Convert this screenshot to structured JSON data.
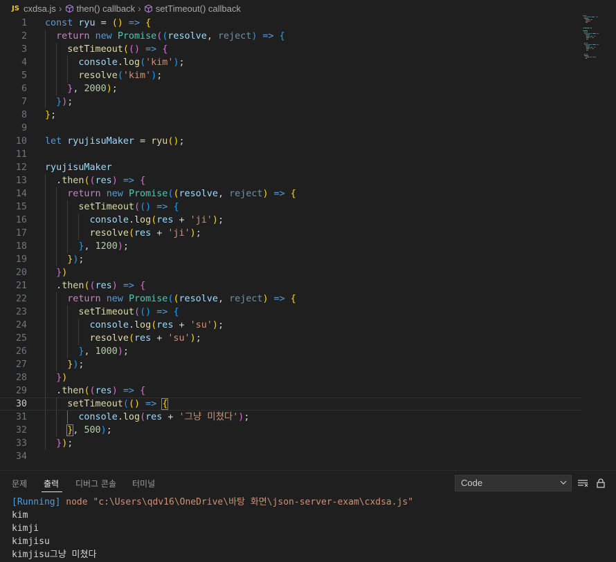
{
  "breadcrumb": {
    "file_badge": "JS",
    "file": "cxdsa.js",
    "items": [
      "then() callback",
      "setTimeout() callback"
    ]
  },
  "editor": {
    "active_line": 30,
    "lines": [
      [
        [
          "t-kw",
          "const "
        ],
        [
          "t-var",
          "ryu"
        ],
        [
          "t-op",
          " = "
        ],
        [
          "t-p1",
          "()"
        ],
        [
          "t-arrow",
          " =>"
        ],
        [
          "t-op",
          " "
        ],
        [
          "t-p1",
          "{"
        ]
      ],
      [
        [
          "t-def",
          "  "
        ],
        [
          "t-ctl",
          "return "
        ],
        [
          "t-kw",
          "new "
        ],
        [
          "t-cls",
          "Promise"
        ],
        [
          "t-p2",
          "("
        ],
        [
          "t-p3",
          "("
        ],
        [
          "t-var",
          "resolve"
        ],
        [
          "t-op",
          ", "
        ],
        [
          "t-unused",
          "reject"
        ],
        [
          "t-p3",
          ")"
        ],
        [
          "t-arrow",
          " =>"
        ],
        [
          "t-op",
          " "
        ],
        [
          "t-p3",
          "{"
        ]
      ],
      [
        [
          "t-def",
          "    "
        ],
        [
          "t-fn",
          "setTimeout"
        ],
        [
          "t-p1",
          "("
        ],
        [
          "t-p2",
          "()"
        ],
        [
          "t-arrow",
          " =>"
        ],
        [
          "t-op",
          " "
        ],
        [
          "t-p2",
          "{"
        ]
      ],
      [
        [
          "t-def",
          "      "
        ],
        [
          "t-var",
          "console"
        ],
        [
          "t-op",
          "."
        ],
        [
          "t-fn",
          "log"
        ],
        [
          "t-p3",
          "("
        ],
        [
          "t-str",
          "'kim'"
        ],
        [
          "t-p3",
          ")"
        ],
        [
          "t-op",
          ";"
        ]
      ],
      [
        [
          "t-def",
          "      "
        ],
        [
          "t-fn",
          "resolve"
        ],
        [
          "t-p3",
          "("
        ],
        [
          "t-str",
          "'kim'"
        ],
        [
          "t-p3",
          ")"
        ],
        [
          "t-op",
          ";"
        ]
      ],
      [
        [
          "t-def",
          "    "
        ],
        [
          "t-p2",
          "}"
        ],
        [
          "t-op",
          ", "
        ],
        [
          "t-num",
          "2000"
        ],
        [
          "t-p1",
          ")"
        ],
        [
          "t-op",
          ";"
        ]
      ],
      [
        [
          "t-def",
          "  "
        ],
        [
          "t-p3",
          "}"
        ],
        [
          "t-p2",
          ")"
        ],
        [
          "t-op",
          ";"
        ]
      ],
      [
        [
          "t-p1",
          "}"
        ],
        [
          "t-op",
          ";"
        ]
      ],
      [],
      [
        [
          "t-kw",
          "let "
        ],
        [
          "t-var",
          "ryujisuMaker"
        ],
        [
          "t-op",
          " = "
        ],
        [
          "t-fn",
          "ryu"
        ],
        [
          "t-p1",
          "()"
        ],
        [
          "t-op",
          ";"
        ]
      ],
      [],
      [
        [
          "t-var",
          "ryujisuMaker"
        ]
      ],
      [
        [
          "t-def",
          "  ."
        ],
        [
          "t-fn",
          "then"
        ],
        [
          "t-p1",
          "("
        ],
        [
          "t-p2",
          "("
        ],
        [
          "t-var",
          "res"
        ],
        [
          "t-p2",
          ")"
        ],
        [
          "t-arrow",
          " =>"
        ],
        [
          "t-op",
          " "
        ],
        [
          "t-p2",
          "{"
        ]
      ],
      [
        [
          "t-def",
          "    "
        ],
        [
          "t-ctl",
          "return "
        ],
        [
          "t-kw",
          "new "
        ],
        [
          "t-cls",
          "Promise"
        ],
        [
          "t-p3",
          "("
        ],
        [
          "t-p1",
          "("
        ],
        [
          "t-var",
          "resolve"
        ],
        [
          "t-op",
          ", "
        ],
        [
          "t-unused",
          "reject"
        ],
        [
          "t-p1",
          ")"
        ],
        [
          "t-arrow",
          " =>"
        ],
        [
          "t-op",
          " "
        ],
        [
          "t-p1",
          "{"
        ]
      ],
      [
        [
          "t-def",
          "      "
        ],
        [
          "t-fn",
          "setTimeout"
        ],
        [
          "t-p2",
          "("
        ],
        [
          "t-p3",
          "()"
        ],
        [
          "t-arrow",
          " =>"
        ],
        [
          "t-op",
          " "
        ],
        [
          "t-p3",
          "{"
        ]
      ],
      [
        [
          "t-def",
          "        "
        ],
        [
          "t-var",
          "console"
        ],
        [
          "t-op",
          "."
        ],
        [
          "t-fn",
          "log"
        ],
        [
          "t-p1",
          "("
        ],
        [
          "t-var",
          "res"
        ],
        [
          "t-op",
          " + "
        ],
        [
          "t-str",
          "'ji'"
        ],
        [
          "t-p1",
          ")"
        ],
        [
          "t-op",
          ";"
        ]
      ],
      [
        [
          "t-def",
          "        "
        ],
        [
          "t-fn",
          "resolve"
        ],
        [
          "t-p1",
          "("
        ],
        [
          "t-var",
          "res"
        ],
        [
          "t-op",
          " + "
        ],
        [
          "t-str",
          "'ji'"
        ],
        [
          "t-p1",
          ")"
        ],
        [
          "t-op",
          ";"
        ]
      ],
      [
        [
          "t-def",
          "      "
        ],
        [
          "t-p3",
          "}"
        ],
        [
          "t-op",
          ", "
        ],
        [
          "t-num",
          "1200"
        ],
        [
          "t-p2",
          ")"
        ],
        [
          "t-op",
          ";"
        ]
      ],
      [
        [
          "t-def",
          "    "
        ],
        [
          "t-p1",
          "}"
        ],
        [
          "t-p3",
          ")"
        ],
        [
          "t-op",
          ";"
        ]
      ],
      [
        [
          "t-def",
          "  "
        ],
        [
          "t-p2",
          "}"
        ],
        [
          "t-p1",
          ")"
        ]
      ],
      [
        [
          "t-def",
          "  ."
        ],
        [
          "t-fn",
          "then"
        ],
        [
          "t-p1",
          "("
        ],
        [
          "t-p2",
          "("
        ],
        [
          "t-var",
          "res"
        ],
        [
          "t-p2",
          ")"
        ],
        [
          "t-arrow",
          " =>"
        ],
        [
          "t-op",
          " "
        ],
        [
          "t-p2",
          "{"
        ]
      ],
      [
        [
          "t-def",
          "    "
        ],
        [
          "t-ctl",
          "return "
        ],
        [
          "t-kw",
          "new "
        ],
        [
          "t-cls",
          "Promise"
        ],
        [
          "t-p3",
          "("
        ],
        [
          "t-p1",
          "("
        ],
        [
          "t-var",
          "resolve"
        ],
        [
          "t-op",
          ", "
        ],
        [
          "t-unused",
          "reject"
        ],
        [
          "t-p1",
          ")"
        ],
        [
          "t-arrow",
          " =>"
        ],
        [
          "t-op",
          " "
        ],
        [
          "t-p1",
          "{"
        ]
      ],
      [
        [
          "t-def",
          "      "
        ],
        [
          "t-fn",
          "setTimeout"
        ],
        [
          "t-p2",
          "("
        ],
        [
          "t-p3",
          "()"
        ],
        [
          "t-arrow",
          " =>"
        ],
        [
          "t-op",
          " "
        ],
        [
          "t-p3",
          "{"
        ]
      ],
      [
        [
          "t-def",
          "        "
        ],
        [
          "t-var",
          "console"
        ],
        [
          "t-op",
          "."
        ],
        [
          "t-fn",
          "log"
        ],
        [
          "t-p1",
          "("
        ],
        [
          "t-var",
          "res"
        ],
        [
          "t-op",
          " + "
        ],
        [
          "t-str",
          "'su'"
        ],
        [
          "t-p1",
          ")"
        ],
        [
          "t-op",
          ";"
        ]
      ],
      [
        [
          "t-def",
          "        "
        ],
        [
          "t-fn",
          "resolve"
        ],
        [
          "t-p1",
          "("
        ],
        [
          "t-var",
          "res"
        ],
        [
          "t-op",
          " + "
        ],
        [
          "t-str",
          "'su'"
        ],
        [
          "t-p1",
          ")"
        ],
        [
          "t-op",
          ";"
        ]
      ],
      [
        [
          "t-def",
          "      "
        ],
        [
          "t-p3",
          "}"
        ],
        [
          "t-op",
          ", "
        ],
        [
          "t-num",
          "1000"
        ],
        [
          "t-p2",
          ")"
        ],
        [
          "t-op",
          ";"
        ]
      ],
      [
        [
          "t-def",
          "    "
        ],
        [
          "t-p1",
          "}"
        ],
        [
          "t-p3",
          ")"
        ],
        [
          "t-op",
          ";"
        ]
      ],
      [
        [
          "t-def",
          "  "
        ],
        [
          "t-p2",
          "}"
        ],
        [
          "t-p1",
          ")"
        ]
      ],
      [
        [
          "t-def",
          "  ."
        ],
        [
          "t-fn",
          "then"
        ],
        [
          "t-p1",
          "("
        ],
        [
          "t-p2",
          "("
        ],
        [
          "t-var",
          "res"
        ],
        [
          "t-p2",
          ")"
        ],
        [
          "t-arrow",
          " =>"
        ],
        [
          "t-op",
          " "
        ],
        [
          "t-p2",
          "{"
        ]
      ],
      [
        [
          "t-def",
          "    "
        ],
        [
          "t-fn",
          "setTimeout"
        ],
        [
          "t-p3",
          "("
        ],
        [
          "t-p1",
          "()"
        ],
        [
          "t-arrow",
          " =>"
        ],
        [
          "t-op",
          " "
        ],
        [
          "t-p1 bracket-hl",
          "{"
        ]
      ],
      [
        [
          "t-def",
          "      "
        ],
        [
          "t-var",
          "console"
        ],
        [
          "t-op",
          "."
        ],
        [
          "t-fn",
          "log"
        ],
        [
          "t-p2",
          "("
        ],
        [
          "t-var",
          "res"
        ],
        [
          "t-op",
          " + "
        ],
        [
          "t-str",
          "'그냥 미쳤다'"
        ],
        [
          "t-p2",
          ")"
        ],
        [
          "t-op",
          ";"
        ]
      ],
      [
        [
          "t-def",
          "    "
        ],
        [
          "t-p1 bracket-hl",
          "}"
        ],
        [
          "t-op",
          ", "
        ],
        [
          "t-num",
          "500"
        ],
        [
          "t-p3",
          ")"
        ],
        [
          "t-op",
          ";"
        ]
      ],
      [
        [
          "t-def",
          "  "
        ],
        [
          "t-p2",
          "}"
        ],
        [
          "t-p1",
          ")"
        ],
        [
          "t-op",
          ";"
        ]
      ],
      []
    ]
  },
  "panel": {
    "tabs": [
      "문제",
      "출력",
      "디버그 콘솔",
      "터미널"
    ],
    "active_tab": 1,
    "select_value": "Code",
    "output": [
      [
        [
          "o-run",
          "[Running] "
        ],
        [
          "o-cmd",
          "node \"c:\\Users\\qdv16\\OneDrive\\바탕 화면\\json-server-exam\\cxdsa.js\""
        ]
      ],
      [
        [
          "o-text",
          "kim"
        ]
      ],
      [
        [
          "o-text",
          "kimji"
        ]
      ],
      [
        [
          "o-text",
          "kimjisu"
        ]
      ],
      [
        [
          "o-text",
          "kimjisu그냥 미쳤다"
        ]
      ]
    ]
  }
}
